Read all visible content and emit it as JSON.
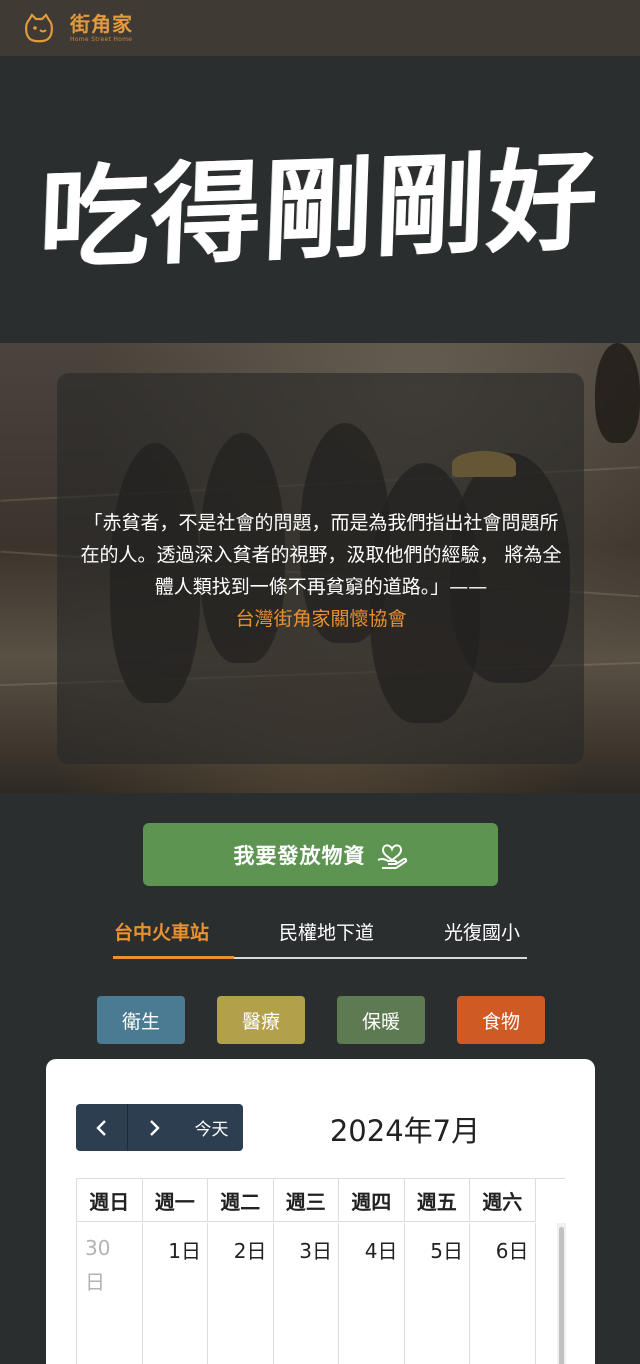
{
  "header": {
    "logo_cn": "街角家",
    "logo_en": "Home Street Home",
    "logo_icon": "smiling-face-icon"
  },
  "hero": {
    "title": "吃得剛剛好"
  },
  "quote": {
    "text": "「赤貧者，不是社會的問題，而是為我們指出社會問題所在的人。透過深入貧者的視野，汲取他們的經驗， 將為全體人類找到一條不再貧窮的道路。」——",
    "author": "台灣街角家關懷協會"
  },
  "cta": {
    "label": "我要發放物資",
    "icon": "heart-hand-icon"
  },
  "tabs": [
    {
      "label": "台中火車站",
      "active": true
    },
    {
      "label": "民權地下道",
      "active": false
    },
    {
      "label": "光復國小",
      "active": false
    }
  ],
  "categories": [
    {
      "label": "衛生",
      "color": "#4a7b93"
    },
    {
      "label": "醫療",
      "color": "#b3a04a"
    },
    {
      "label": "保暖",
      "color": "#5e7a52"
    },
    {
      "label": "食物",
      "color": "#cf5a24"
    }
  ],
  "calendar": {
    "title": "2024年7月",
    "prev_icon": "chevron-left-icon",
    "next_icon": "chevron-right-icon",
    "today_label": "今天",
    "weekdays": [
      "週日",
      "週一",
      "週二",
      "週三",
      "週四",
      "週五",
      "週六"
    ],
    "days": [
      "30日",
      "1日",
      "2日",
      "3日",
      "4日",
      "5日",
      "6日"
    ]
  },
  "colors": {
    "header_bg": "#3f3a33",
    "page_bg": "#2b2e2f",
    "accent": "#e8912f",
    "cta_bg": "#5e9451",
    "calendar_nav_bg": "#2c3e50"
  }
}
